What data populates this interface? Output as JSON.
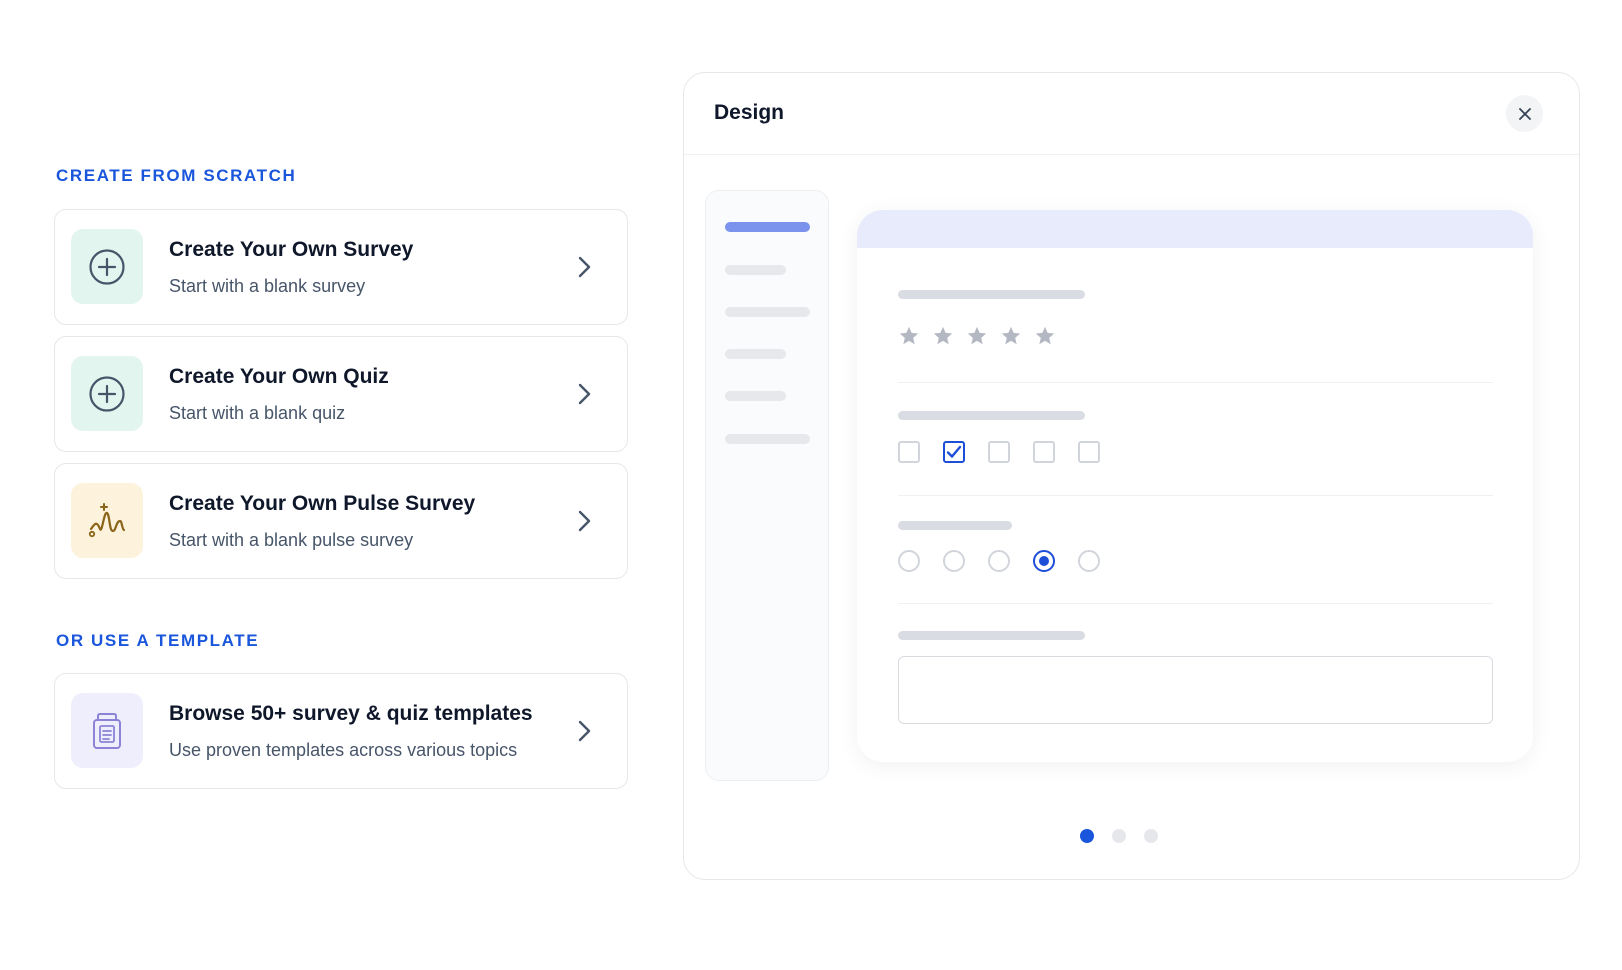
{
  "scratch_section": {
    "label": "CREATE FROM SCRATCH",
    "cards": [
      {
        "title": "Create Your Own Survey",
        "subtitle": "Start with a blank survey",
        "icon": "plus-circle-icon",
        "tile_color": "#e3f5ef"
      },
      {
        "title": "Create Your Own Quiz",
        "subtitle": "Start with a blank quiz",
        "icon": "plus-circle-icon",
        "tile_color": "#e3f5ef"
      },
      {
        "title": "Create Your Own Pulse Survey",
        "subtitle": "Start with a blank pulse survey",
        "icon": "pulse-icon",
        "tile_color": "#fdf2dc"
      }
    ]
  },
  "template_section": {
    "label": "OR USE A TEMPLATE",
    "cards": [
      {
        "title": "Browse 50+ survey & quiz templates",
        "subtitle": "Use proven templates across various topics",
        "icon": "document-icon",
        "tile_color": "#efeefd"
      }
    ]
  },
  "design_panel": {
    "title": "Design",
    "rating_stars": 5,
    "checkboxes": {
      "count": 5,
      "checked_index": 1
    },
    "radios": {
      "count": 5,
      "selected_index": 3
    },
    "carousel": {
      "pages": 3,
      "active_index": 0
    }
  },
  "colors": {
    "accent": "#1a56db",
    "selection": "#1d4ed8",
    "sidebar_active": "#7b93ec",
    "form_header": "#e7ebfc",
    "pulse_icon": "#8a6418",
    "document_icon": "#8c83d6",
    "plus_icon": "#475569"
  }
}
